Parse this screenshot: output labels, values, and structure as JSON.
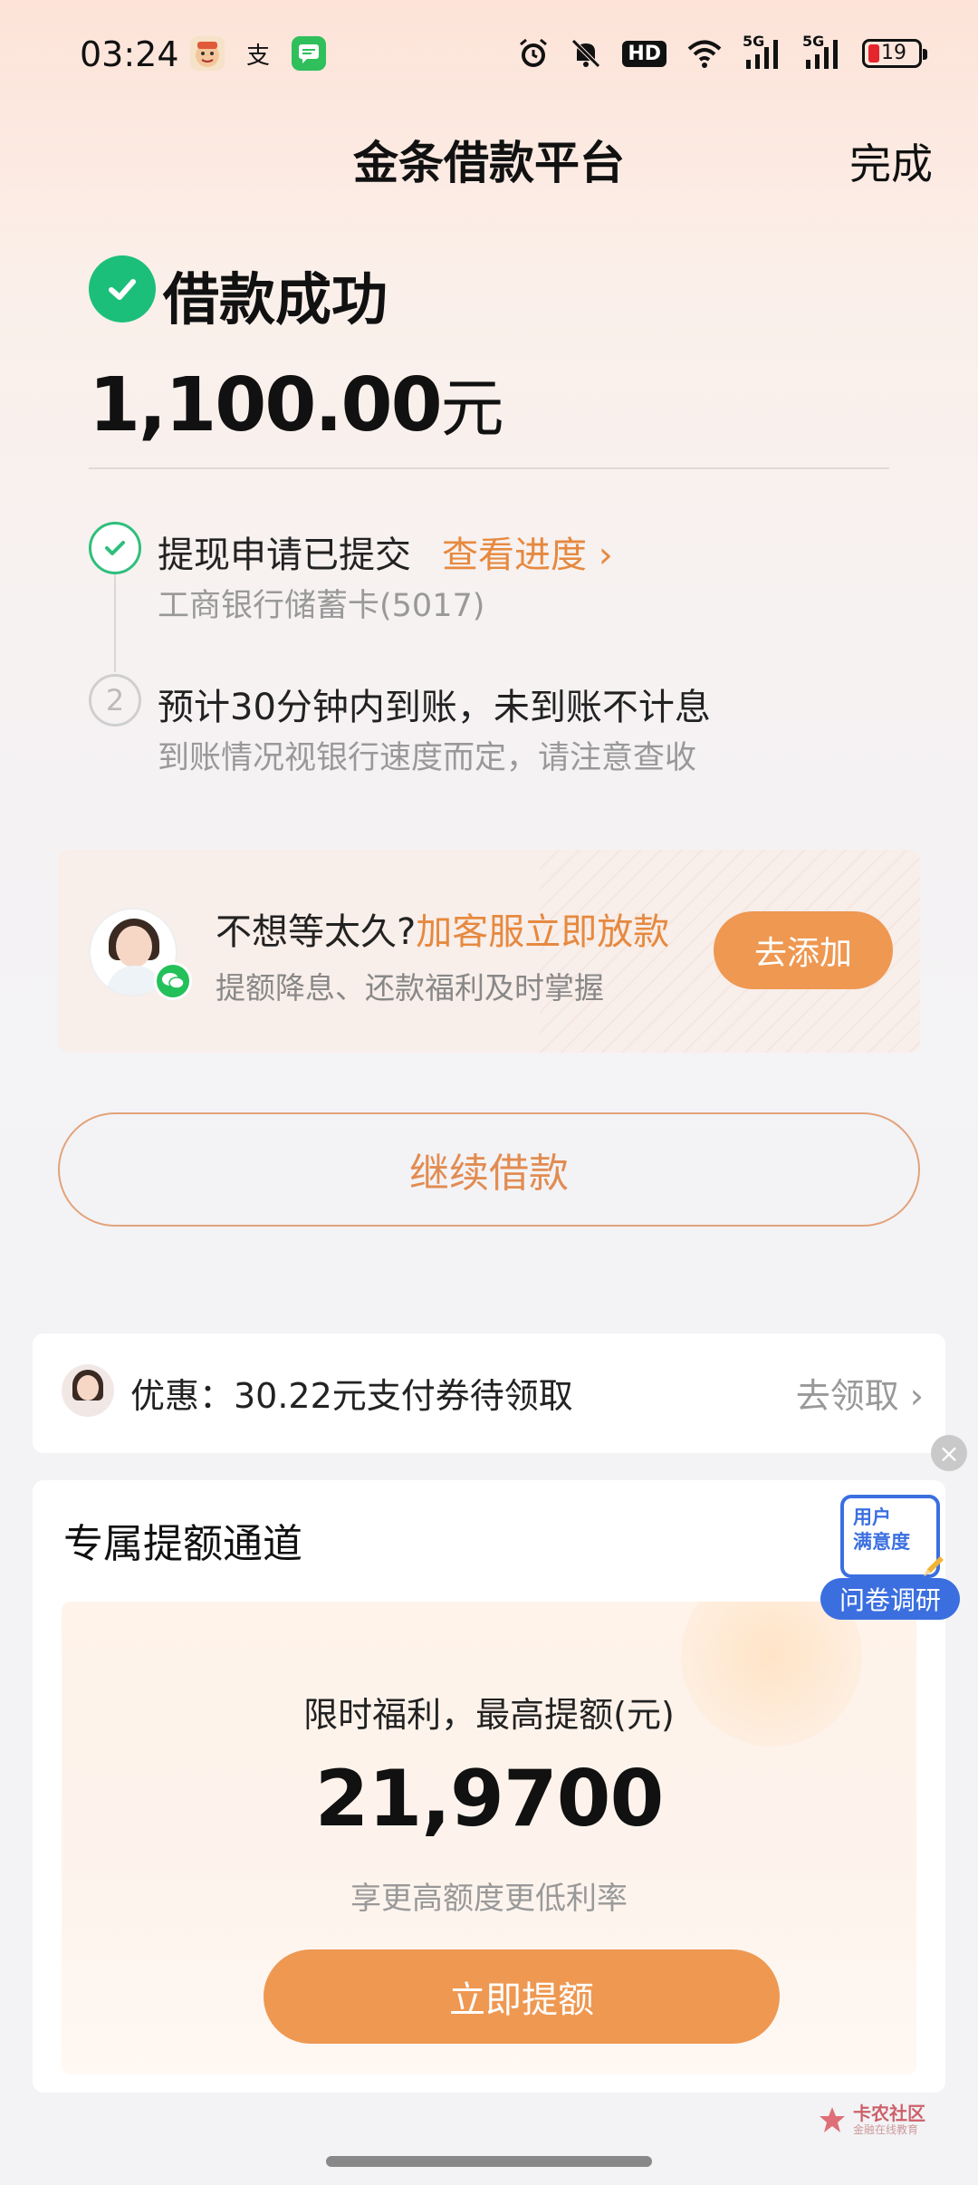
{
  "status_bar": {
    "time": "03:24",
    "app_icons": [
      "emoji-app-icon",
      "alipay-icon",
      "messages-icon"
    ],
    "alipay_glyph": "支",
    "right_icons": [
      "alarm-icon",
      "mute-icon",
      "hd-icon",
      "wifi-icon",
      "signal-5g-icon",
      "signal-5g-icon",
      "battery-icon"
    ],
    "hd_label": "HD",
    "signal1_label": "5G",
    "signal2_label": "5G",
    "battery_level": "19"
  },
  "header": {
    "title": "金条借款平台",
    "done_label": "完成"
  },
  "result": {
    "status": "借款成功",
    "amount": "1,100.00",
    "unit": "元"
  },
  "steps": [
    {
      "title": "提现申请已提交",
      "link": "查看进度 ›",
      "sub": "工商银行储蓄卡(5017)"
    },
    {
      "number": "2",
      "title": "预计30分钟内到账，未到账不计息",
      "sub": "到账情况视银行速度而定，请注意查收"
    }
  ],
  "service_card": {
    "title_prefix": "不想等太久?",
    "title_highlight": "加客服立即放款",
    "subtitle": "提额降息、还款福利及时掌握",
    "button": "去添加"
  },
  "continue_button": "继续借款",
  "coupon": {
    "text": "优惠：30.22元支付券待领取",
    "action": "去领取 ›"
  },
  "exclusive": {
    "title": "专属提额通道",
    "label": "限时福利，最高提额(元)",
    "amount": "21,9700",
    "note": "享更高额度更低利率",
    "button": "立即提额"
  },
  "survey": {
    "doc_line1": "用户",
    "doc_line2": "满意度",
    "tag": "问卷调研"
  },
  "watermark": {
    "name": "卡农社区",
    "sub": "金融在线教育"
  },
  "colors": {
    "accent": "#ee9852",
    "link": "#e6893f",
    "success": "#1bbf7a",
    "survey": "#3b6fe0"
  }
}
